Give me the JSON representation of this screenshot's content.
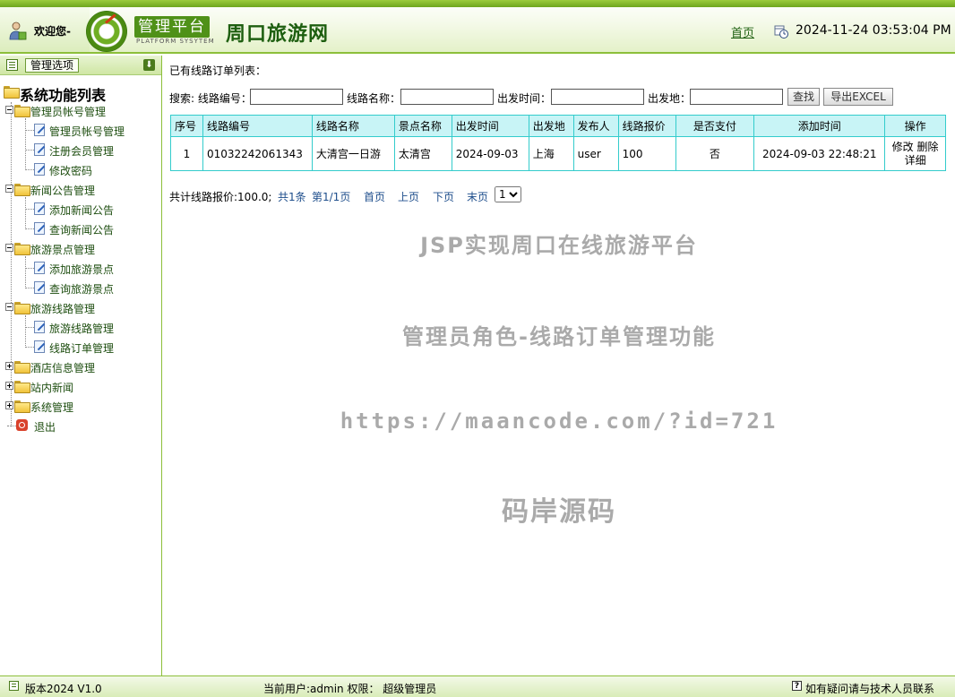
{
  "header": {
    "welcome": "欢迎您-",
    "logo_title": "管理平台",
    "logo_sub": "PLATFORM SYSYTEM",
    "site_name": "周口旅游网",
    "home_link": "首页",
    "datetime": "2024-11-24 03:53:04 PM",
    "icons": [
      "user-icon",
      "logo-emblem-icon",
      "clock-icon"
    ]
  },
  "sidebar": {
    "title": "管理选项",
    "root": "系统功能列表",
    "groups": [
      {
        "label": "管理员帐号管理",
        "expanded": true,
        "items": [
          "管理员帐号管理",
          "注册会员管理",
          "修改密码"
        ]
      },
      {
        "label": "新闻公告管理",
        "expanded": true,
        "items": [
          "添加新闻公告",
          "查询新闻公告"
        ]
      },
      {
        "label": "旅游景点管理",
        "expanded": true,
        "items": [
          "添加旅游景点",
          "查询旅游景点"
        ]
      },
      {
        "label": "旅游线路管理",
        "expanded": true,
        "items": [
          "旅游线路管理",
          "线路订单管理"
        ]
      },
      {
        "label": "酒店信息管理",
        "expanded": false,
        "items": []
      },
      {
        "label": "站内新闻",
        "expanded": false,
        "items": []
      },
      {
        "label": "系统管理",
        "expanded": false,
        "items": []
      }
    ],
    "logout": "退出"
  },
  "main": {
    "list_title": "已有线路订单列表：",
    "search": {
      "prefix": "搜索: 线路编号：",
      "route_name_label": "线路名称：",
      "depart_time_label": "出发时间：",
      "depart_place_label": "出发地：",
      "route_no_value": "",
      "route_name_value": "",
      "depart_time_value": "",
      "depart_place_value": "",
      "find_button": "查找",
      "export_button": "导出EXCEL"
    },
    "table": {
      "columns": [
        "序号",
        "线路编号",
        "线路名称",
        "景点名称",
        "出发时间",
        "出发地",
        "发布人",
        "线路报价",
        "是否支付",
        "添加时间",
        "操作"
      ],
      "rows": [
        {
          "index": "1",
          "route_no": "01032242061343",
          "route_name": "大清宫一日游",
          "scenic": "太清宫",
          "depart_time": "2024-09-03",
          "depart_place": "上海",
          "publisher": "user",
          "price": "100",
          "paid": "否",
          "added": "2024-09-03 22:48:21",
          "op_edit": "修改",
          "op_delete": "删除",
          "op_detail": "详细"
        }
      ]
    },
    "pager": {
      "summary": "共计线路报价:100.0;",
      "total": "共1条",
      "page": "第1/1页",
      "first": "首页",
      "prev": "上页",
      "next": "下页",
      "last": "末页",
      "selected": "1"
    },
    "watermarks": [
      "JSP实现周口在线旅游平台",
      "管理员角色-线路订单管理功能",
      "https://maancode.com/?id=721",
      "码岸源码"
    ]
  },
  "footer": {
    "version": "版本2024 V1.0",
    "current_user": "当前用户:admin 权限：  超级管理员",
    "help": "如有疑问请与技术人员联系"
  },
  "colors": {
    "accent_green": "#8cbf3a",
    "table_border": "#33cccc",
    "table_header_bg": "#c8f4f6"
  }
}
